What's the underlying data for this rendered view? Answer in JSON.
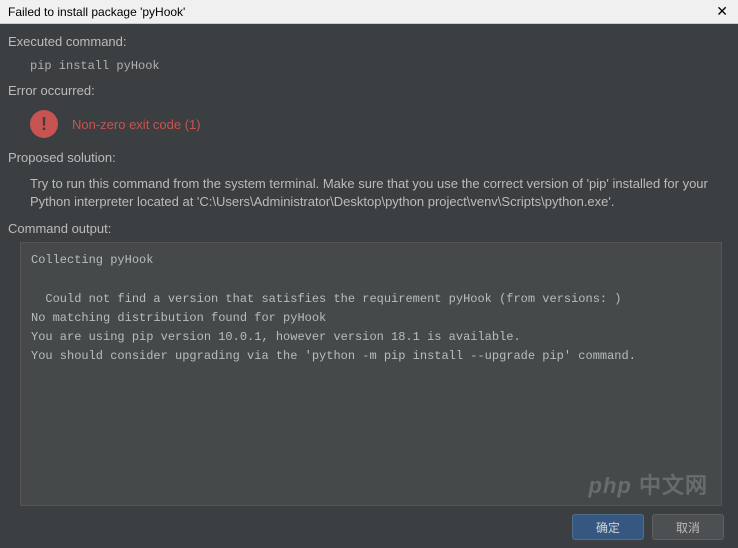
{
  "window": {
    "title": "Failed to install package 'pyHook'"
  },
  "labels": {
    "executed_command": "Executed command:",
    "error_occurred": "Error occurred:",
    "proposed_solution": "Proposed solution:",
    "command_output": "Command output:"
  },
  "executed_command": "pip install pyHook",
  "error": {
    "icon_glyph": "!",
    "message": "Non-zero exit code (1)"
  },
  "solution_text": "Try to run this command from the system terminal. Make sure that you use the correct version of 'pip' installed for your Python interpreter located at 'C:\\Users\\Administrator\\Desktop\\python project\\venv\\Scripts\\python.exe'.",
  "output_lines": [
    "Collecting pyHook",
    "",
    "  Could not find a version that satisfies the requirement pyHook (from versions: )",
    "No matching distribution found for pyHook",
    "You are using pip version 10.0.1, however version 18.1 is available.",
    "You should consider upgrading via the 'python -m pip install --upgrade pip' command."
  ],
  "buttons": {
    "ok": "确定",
    "cancel": "取消"
  },
  "watermark": "php 中文网"
}
